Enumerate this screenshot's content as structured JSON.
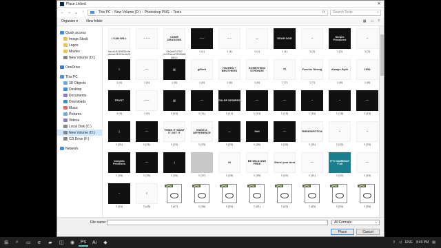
{
  "dialog": {
    "title": "Place Linked",
    "breadcrumb": [
      "This PC",
      "New Volume (D:)",
      "Photoshop PNG",
      "Texts"
    ],
    "search_placeholder": "Search Texts"
  },
  "toolbar": {
    "organize": "Organize ▾",
    "new_folder": "New folder"
  },
  "nav": [
    {
      "label": "Quick access",
      "color": "#3a8ee6",
      "indent": 0
    },
    {
      "label": "Image Stock",
      "color": "#e8c24a",
      "indent": 1
    },
    {
      "label": "Logos",
      "color": "#e8c24a",
      "indent": 1
    },
    {
      "label": "Movies",
      "color": "#e8c24a",
      "indent": 1
    },
    {
      "label": "New Volume (D:)",
      "color": "#888888",
      "indent": 1
    },
    {
      "label": "",
      "spacer": true
    },
    {
      "label": "OneDrive",
      "color": "#3a7bd5",
      "indent": 0
    },
    {
      "label": "",
      "spacer": true
    },
    {
      "label": "This PC",
      "color": "#4a90d9",
      "indent": 0
    },
    {
      "label": "3D Objects",
      "color": "#6fa8dc",
      "indent": 1
    },
    {
      "label": "Desktop",
      "color": "#3a8ee6",
      "indent": 1
    },
    {
      "label": "Documents",
      "color": "#8e7cc3",
      "indent": 1
    },
    {
      "label": "Downloads",
      "color": "#3a8ee6",
      "indent": 1
    },
    {
      "label": "Music",
      "color": "#e06666",
      "indent": 1
    },
    {
      "label": "Pictures",
      "color": "#6fa8dc",
      "indent": 1
    },
    {
      "label": "Videos",
      "color": "#8e7cc3",
      "indent": 1
    },
    {
      "label": "Local Disk (C:)",
      "color": "#888888",
      "indent": 1
    },
    {
      "label": "New Volume (D:)",
      "color": "#888888",
      "indent": 1,
      "selected": true
    },
    {
      "label": "CD Drive (F:)",
      "color": "#888888",
      "indent": 1
    },
    {
      "label": "",
      "spacer": true
    },
    {
      "label": "Network",
      "color": "#3a8ee6",
      "indent": 0
    }
  ],
  "files": [
    {
      "label": "0a1e152395551fe abca131002e4c24",
      "style": "light",
      "text": "I CAN WILL"
    },
    {
      "label": "",
      "style": "light",
      "text": "~ ~ ~"
    },
    {
      "label": "0fc2e874752 2c100cba7509088 389 1",
      "style": "light",
      "text": "COME DRAGONS"
    },
    {
      "label": "1 (1)",
      "style": "dark",
      "text": "~~~"
    },
    {
      "label": "1 (1)",
      "style": "light",
      "text": "~ ~"
    },
    {
      "label": "1 (1)",
      "style": "light",
      "text": "—"
    },
    {
      "label": "1 (1)",
      "style": "dark",
      "text": "DEAR GOD"
    },
    {
      "label": "1 (2)",
      "style": "light",
      "text": "~"
    },
    {
      "label": "1 (3)",
      "style": "dark",
      "text": "Simple Pleasures"
    },
    {
      "label": "1 (3)",
      "style": "light",
      "text": "~"
    },
    {
      "label": "1 (4)",
      "style": "dark",
      "text": "≡"
    },
    {
      "label": "1 (4)",
      "style": "light",
      "text": "~~"
    },
    {
      "label": "1 (5)",
      "style": "dark",
      "text": "|||"
    },
    {
      "label": "1 (5)",
      "style": "light",
      "text": "glibert"
    },
    {
      "label": "1 (6)",
      "style": "light",
      "text": "HATRED + BROTHERS"
    },
    {
      "label": "1 (6)",
      "style": "light",
      "text": "SOMETHING STRONGE"
    },
    {
      "label": "1 (7)",
      "style": "light",
      "text": "⛫"
    },
    {
      "label": "1 (7)",
      "style": "light",
      "text": "Forever Strong"
    },
    {
      "label": "1 (8)",
      "style": "light",
      "text": "Always Style"
    },
    {
      "label": "1 (8)",
      "style": "light",
      "text": "1994"
    },
    {
      "label": "1 (9)",
      "style": "dark",
      "text": "TRUST"
    },
    {
      "label": "1 (9)",
      "style": "light",
      "text": "~~~"
    },
    {
      "label": "1 (10)",
      "style": "dark",
      "text": "|||"
    },
    {
      "label": "1 (11)",
      "style": "dark",
      "text": "~~"
    },
    {
      "label": "1 (14)",
      "style": "dark",
      "text": "FALSE DESIRES"
    },
    {
      "label": "1 (14)",
      "style": "dark",
      "text": "~~"
    },
    {
      "label": "1 (15)",
      "style": "dark",
      "text": "~~"
    },
    {
      "label": "1 (16)",
      "style": "dark",
      "text": "~"
    },
    {
      "label": "1 (18)",
      "style": "dark",
      "text": "~"
    },
    {
      "label": "1 (19)",
      "style": "dark",
      "text": "~~"
    },
    {
      "label": "1 (21)",
      "style": "dark",
      "text": "|"
    },
    {
      "label": "1 (21)",
      "style": "dark",
      "text": "~~"
    },
    {
      "label": "1 (22)",
      "style": "light",
      "text": "THINK IT WANT IT GET IT"
    },
    {
      "label": "1 (23)",
      "style": "light",
      "text": "MAKE A DIFFERENCE"
    },
    {
      "label": "1 (25)",
      "style": "dark",
      "text": "—"
    },
    {
      "label": "1 (26)",
      "style": "dark",
      "text": "Salt"
    },
    {
      "label": "1 (30)",
      "style": "dark",
      "text": "~~"
    },
    {
      "label": "1 (31)",
      "style": "light",
      "text": "FRIENDSPOTCAL"
    },
    {
      "label": "1 (32)",
      "style": "light",
      "text": "~"
    },
    {
      "label": "1 (33)",
      "style": "light",
      "text": "~"
    },
    {
      "label": "1 (34)",
      "style": "dark",
      "text": "Insights Promises"
    },
    {
      "label": "1 (35)",
      "style": "dark",
      "text": "~~"
    },
    {
      "label": "1 (36)",
      "style": "dark",
      "text": "|"
    },
    {
      "label": "1 (37)",
      "style": "grey",
      "text": ""
    },
    {
      "label": "1 (38)",
      "style": "light",
      "text": "W"
    },
    {
      "label": "1 (39)",
      "style": "light",
      "text": "BE WILD AND FREE"
    },
    {
      "label": "1 (40)",
      "style": "light",
      "text": "Shine your best"
    },
    {
      "label": "1 (41)",
      "style": "light",
      "text": "~~"
    },
    {
      "label": "1 (42)",
      "style": "teal",
      "text": "IT'S GAMEDAY Y'all"
    },
    {
      "label": "1 (43)",
      "style": "light",
      "text": "~~"
    },
    {
      "label": "1 (44)",
      "style": "dark",
      "text": "~"
    },
    {
      "label": "1 (45)",
      "style": "light",
      "text": "≡"
    },
    {
      "label": "1 (47)",
      "style": "jpg",
      "text": "JPG"
    },
    {
      "label": "1 (48)",
      "style": "jpg",
      "text": "JPG"
    },
    {
      "label": "1 (50)",
      "style": "jpg",
      "text": "JPG"
    },
    {
      "label": "1 (51)",
      "style": "jpg",
      "text": "JPG"
    },
    {
      "label": "1 (52)",
      "style": "jpg",
      "text": "JPG"
    },
    {
      "label": "1 (53)",
      "style": "jpg",
      "text": "JPG"
    },
    {
      "label": "1 (54)",
      "style": "jpg",
      "text": "JPG"
    },
    {
      "label": "1 (55)",
      "style": "jpg",
      "text": "JPG"
    }
  ],
  "footer": {
    "filename_label": "File name:",
    "filetype": "All Formats",
    "place_button": "Place",
    "cancel_button": "Cancel"
  },
  "taskbar": {
    "lang": "ENG",
    "time": "3:49 PM"
  }
}
